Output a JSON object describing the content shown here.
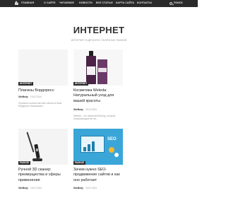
{
  "nav": {
    "items": [
      "ГЛАВНАЯ",
      "О САЙТЕ",
      "ЧИТАЕМОЕ",
      "НОВОСТИ",
      "ВСЕ СТАТЬИ",
      "КАРТА САЙТА",
      "КОНТАКТЫ"
    ],
    "search_label": "ПОИСК"
  },
  "header": {
    "title": "ИНТЕРНЕТ",
    "tagline": "ИНТЕРНЕТ В ДЕТАЛЯХ: ПОЛЕЗНЫЕ ЗНАНИЯ"
  },
  "posts": [
    {
      "badge": "ИНТЕРНЕТ",
      "title": "Плагины Вордпресс:",
      "author": "SiteBody",
      "date": "15.02.2024",
      "excerpt": "Огромное количество веб-сайтов на базе Вордпресс невозможно..."
    },
    {
      "badge": "ИНТЕРНЕТ",
      "title": "Косметика Weleda: Натуральный уход для вашей красоты",
      "author": "SiteBody",
      "date": "15.02.2024",
      "excerpt": "Weleda – это известный бренд, который специализируется на..."
    },
    {
      "badge": "РАЗНОЕ",
      "title": "Ручной 3D сканер: преимущества и сферы применения",
      "author": "SiteBody",
      "date": "15.02.2024",
      "excerpt": ""
    },
    {
      "badge": "РАЗНОЕ",
      "title": "Зачем нужно SEO-продвижение сайтов и как оно работает",
      "author": "SiteBody",
      "date": "15.02.2024",
      "excerpt": ""
    }
  ],
  "seo_image_text": "SEO",
  "colors": {
    "nav_bg": "#2a2a2a",
    "badge_bg": "#2b2b2b",
    "title": "#303030"
  }
}
